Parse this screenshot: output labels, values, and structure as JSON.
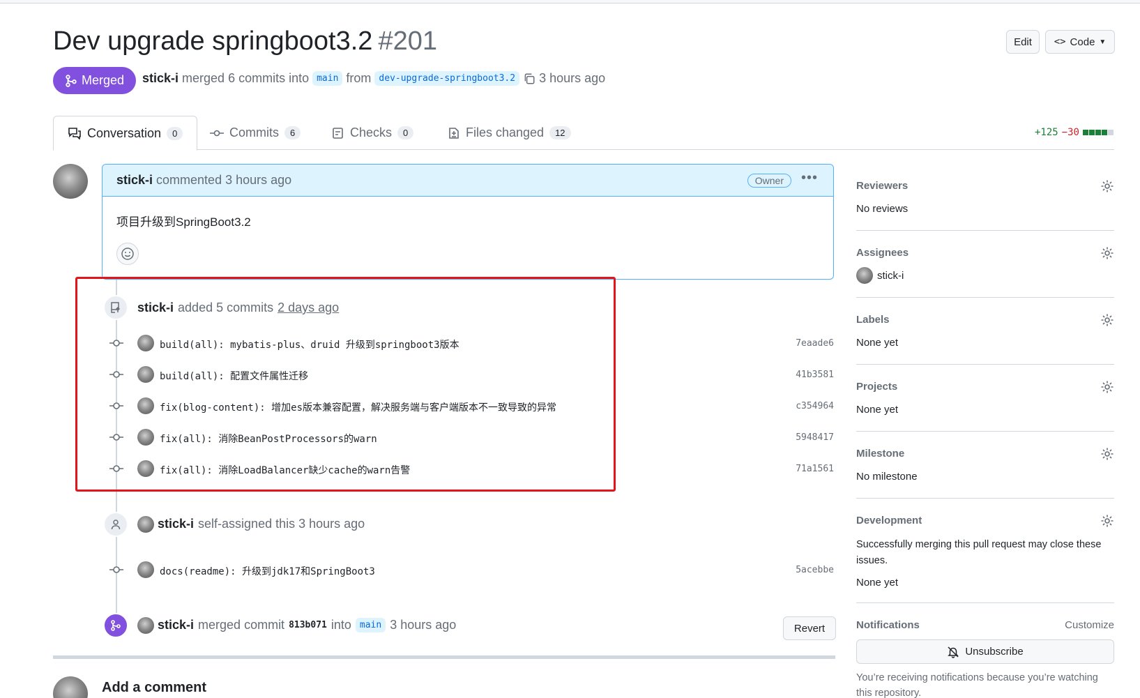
{
  "pr": {
    "title": "Dev upgrade springboot3.2",
    "number": "#201",
    "state": "Merged",
    "author": "stick-i",
    "merge_text": "merged 6 commits into",
    "base_branch": "main",
    "from_text": "from",
    "head_branch": "dev-upgrade-springboot3.2",
    "time": "3 hours ago"
  },
  "header_buttons": {
    "edit": "Edit",
    "code": "Code"
  },
  "tabs": [
    {
      "label": "Conversation",
      "count": "0"
    },
    {
      "label": "Commits",
      "count": "6"
    },
    {
      "label": "Checks",
      "count": "0"
    },
    {
      "label": "Files changed",
      "count": "12"
    }
  ],
  "diffstat": {
    "additions": "+125",
    "deletions": "−30"
  },
  "comment": {
    "author": "stick-i",
    "action": "commented 3 hours ago",
    "role": "Owner",
    "body": "项目升级到SpringBoot3.2"
  },
  "commits_event": {
    "author": "stick-i",
    "action": "added 5 commits",
    "time": "2 days ago",
    "commits": [
      {
        "message": "build(all): mybatis-plus、druid 升级到springboot3版本",
        "sha": "7eaade6"
      },
      {
        "message": "build(all): 配置文件属性迁移",
        "sha": "41b3581"
      },
      {
        "message": "fix(blog-content): 增加es版本兼容配置，解决服务端与客户端版本不一致导致的异常",
        "sha": "c354964"
      },
      {
        "message": "fix(all): 消除BeanPostProcessors的warn",
        "sha": "5948417"
      },
      {
        "message": "fix(all): 消除LoadBalancer缺少cache的warn告警",
        "sha": "71a1561"
      }
    ]
  },
  "assign_event": {
    "author": "stick-i",
    "action": "self-assigned this 3 hours ago"
  },
  "late_commit": {
    "message": "docs(readme): 升级到jdk17和SpringBoot3",
    "sha": "5acebbe"
  },
  "merge_event": {
    "author": "stick-i",
    "action": "merged commit",
    "commit": "813b071",
    "into": "into",
    "branch": "main",
    "time": "3 hours ago",
    "revert": "Revert"
  },
  "add_comment": "Add a comment",
  "sidebar": {
    "reviewers": {
      "title": "Reviewers",
      "value": "No reviews"
    },
    "assignees": {
      "title": "Assignees",
      "value": "stick-i"
    },
    "labels": {
      "title": "Labels",
      "value": "None yet"
    },
    "projects": {
      "title": "Projects",
      "value": "None yet"
    },
    "milestone": {
      "title": "Milestone",
      "value": "No milestone"
    },
    "development": {
      "title": "Development",
      "desc": "Successfully merging this pull request may close these issues.",
      "value": "None yet"
    },
    "notifications": {
      "title": "Notifications",
      "customize": "Customize",
      "unsubscribe": "Unsubscribe",
      "note": "You’re receiving notifications because you’re watching this repository."
    }
  },
  "colors": {
    "merged": "#8250df",
    "highlight": "#e5141a",
    "accent_blue": "#0969da",
    "add": "#1a7f37",
    "del": "#cf222e"
  }
}
